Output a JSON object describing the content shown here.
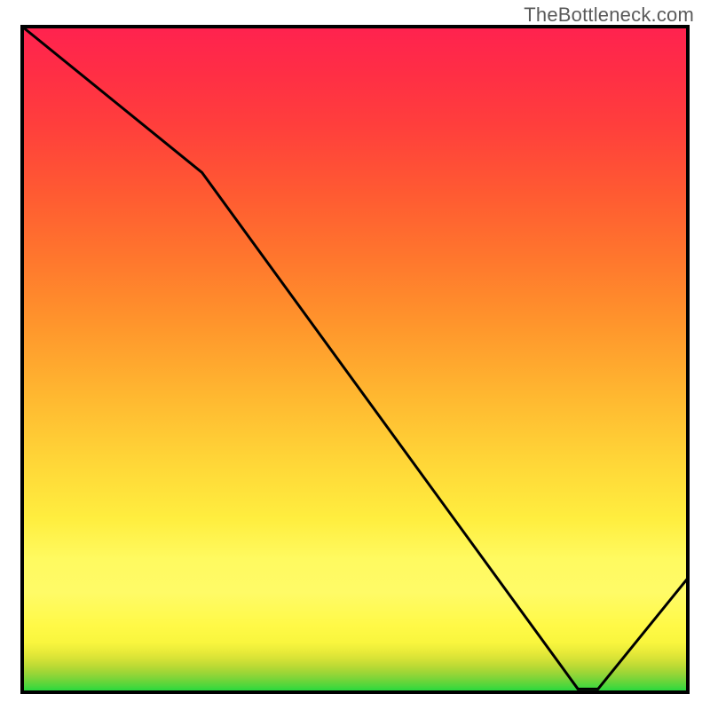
{
  "watermark": "TheBottleneck.com",
  "chart_data": {
    "type": "line",
    "title": "",
    "xlabel": "",
    "ylabel": "",
    "xlim": [
      0,
      100
    ],
    "ylim": [
      0,
      105
    ],
    "axes_visible": false,
    "grid": false,
    "annotation": {
      "text": "",
      "x": 80,
      "y": 1
    },
    "background_gradient": {
      "stops": [
        {
          "offset": 0.0,
          "color": "#1bdc3f"
        },
        {
          "offset": 0.005,
          "color": "#36d83d"
        },
        {
          "offset": 0.01,
          "color": "#4fd73c"
        },
        {
          "offset": 0.015,
          "color": "#64d53a"
        },
        {
          "offset": 0.02,
          "color": "#7ad539"
        },
        {
          "offset": 0.025,
          "color": "#8dd538"
        },
        {
          "offset": 0.03,
          "color": "#9ed636"
        },
        {
          "offset": 0.035,
          "color": "#aed835"
        },
        {
          "offset": 0.04,
          "color": "#bddb35"
        },
        {
          "offset": 0.05,
          "color": "#d5e236"
        },
        {
          "offset": 0.06,
          "color": "#e7ea39"
        },
        {
          "offset": 0.075,
          "color": "#f9f63e"
        },
        {
          "offset": 0.1,
          "color": "#fff947"
        },
        {
          "offset": 0.15,
          "color": "#fffb67"
        },
        {
          "offset": 0.2,
          "color": "#fffa60"
        },
        {
          "offset": 0.26,
          "color": "#ffee3f"
        },
        {
          "offset": 0.35,
          "color": "#ffd537"
        },
        {
          "offset": 0.45,
          "color": "#ffb630"
        },
        {
          "offset": 0.55,
          "color": "#ff962c"
        },
        {
          "offset": 0.65,
          "color": "#ff772d"
        },
        {
          "offset": 0.75,
          "color": "#ff5a32"
        },
        {
          "offset": 0.85,
          "color": "#ff3f3c"
        },
        {
          "offset": 0.93,
          "color": "#ff2e45"
        },
        {
          "offset": 1.0,
          "color": "#ff224f"
        }
      ]
    },
    "series": [
      {
        "name": "curve",
        "points": [
          {
            "x": 0.0,
            "y": 105.0
          },
          {
            "x": 27.0,
            "y": 82.0
          },
          {
            "x": 83.5,
            "y": 0.5
          },
          {
            "x": 86.5,
            "y": 0.5
          },
          {
            "x": 100.0,
            "y": 18.0
          }
        ]
      }
    ]
  }
}
